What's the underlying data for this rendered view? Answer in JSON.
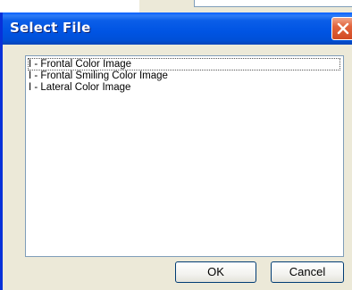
{
  "dialog": {
    "title": "Select File",
    "close_icon": "close-x-icon",
    "files": [
      {
        "label": "I - Frontal Color Image"
      },
      {
        "label": "I - Frontal Smiling Color Image"
      },
      {
        "label": "I - Lateral Color Image"
      }
    ],
    "ok_label": "OK",
    "cancel_label": "Cancel"
  },
  "colors": {
    "titlebar": "#0054e3",
    "close_button": "#e2643d",
    "dialog_face": "#ece9d8",
    "list_border": "#7f9db9"
  }
}
